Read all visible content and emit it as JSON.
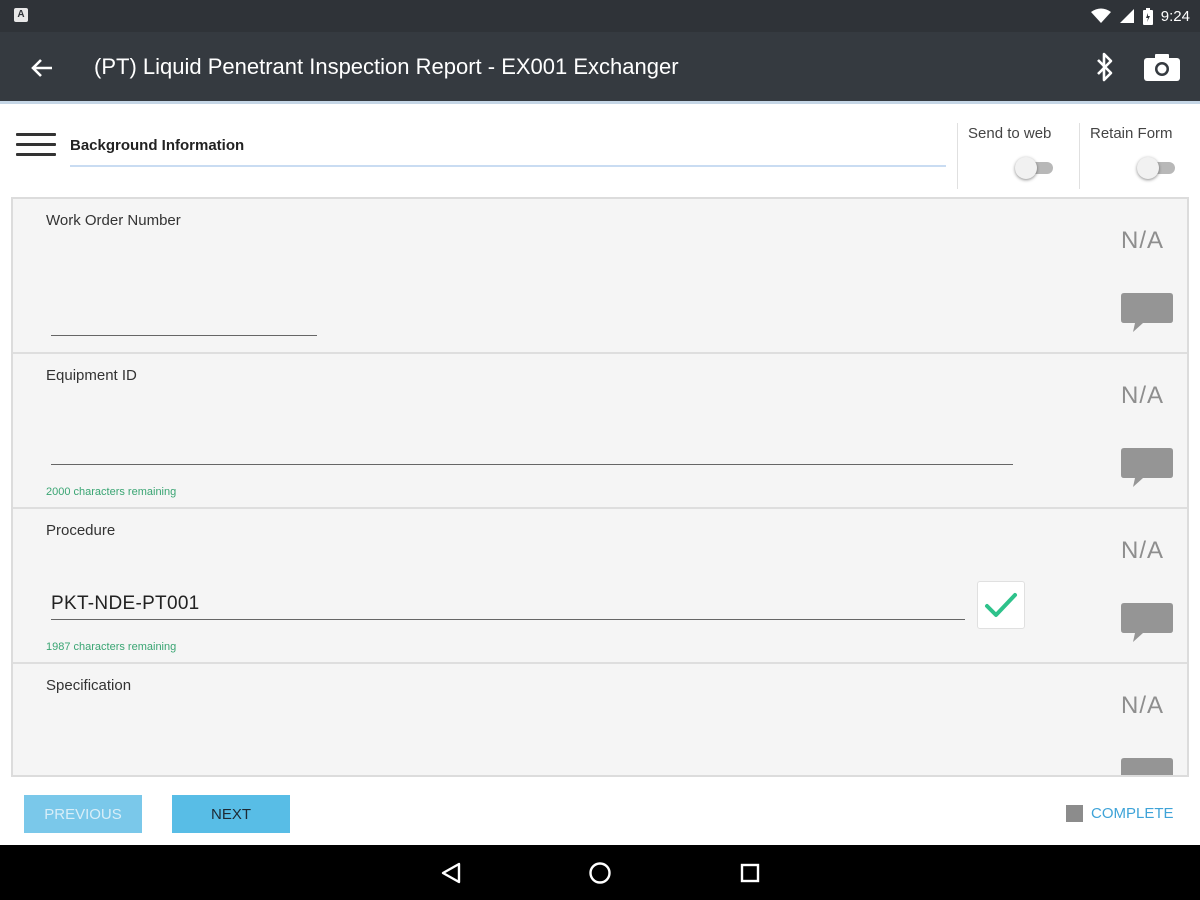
{
  "status_bar": {
    "time": "9:24",
    "icons": [
      "notification-icon",
      "wifi-icon",
      "cell-signal-icon",
      "battery-icon"
    ]
  },
  "app_bar": {
    "title": "(PT) Liquid Penetrant Inspection Report - EX001 Exchanger",
    "icons": [
      "back-arrow-icon",
      "bluetooth-icon",
      "camera-icon"
    ]
  },
  "section": {
    "current": "Background Information"
  },
  "toggles": {
    "send_to_web": {
      "label": "Send to web",
      "on": false
    },
    "retain_form": {
      "label": "Retain Form",
      "on": false
    }
  },
  "questions": [
    {
      "label": "Work Order Number",
      "value": "",
      "remaining": "",
      "na_label": "N/A"
    },
    {
      "label": "Equipment ID",
      "value": "",
      "remaining": "2000 characters remaining",
      "na_label": "N/A"
    },
    {
      "label": "Procedure",
      "value": "PKT-NDE-PT001",
      "remaining": "1987 characters remaining",
      "na_label": "N/A",
      "confirmed": true
    },
    {
      "label": "Specification",
      "value": "",
      "remaining": "",
      "na_label": "N/A"
    }
  ],
  "nav": {
    "previous_label": "PREVIOUS",
    "next_label": "NEXT",
    "complete_label": "COMPLETE",
    "previous_enabled": false
  },
  "colors": {
    "app_bar": "#353a40",
    "accent": "#58bde6",
    "check": "#2ec28b",
    "remaining_text": "#3aa573",
    "complete_text": "#3ea3d8"
  }
}
